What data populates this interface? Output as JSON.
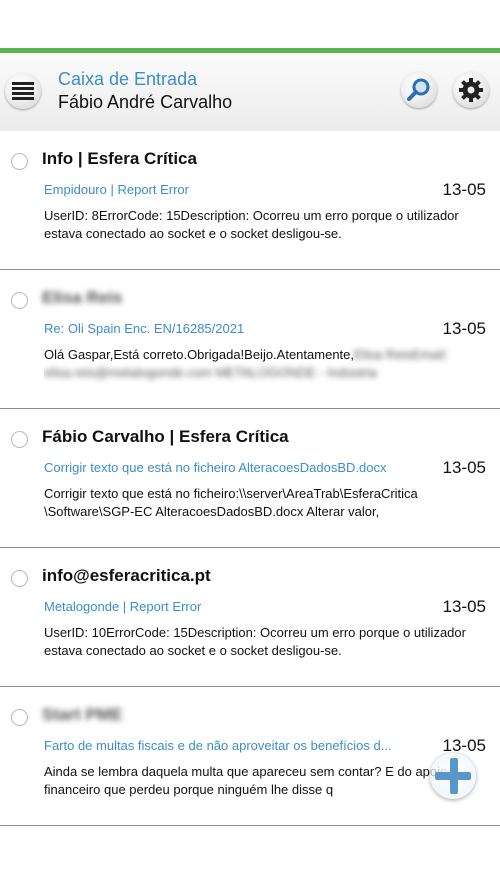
{
  "header": {
    "title": "Caixa de Entrada",
    "user": "Fábio André Carvalho",
    "menu_icon": "hamburger-menu-icon",
    "search_icon": "search-icon",
    "settings_icon": "gear-icon",
    "accent_color": "#3b8ec9",
    "status_bar_color": "#58b84b"
  },
  "messages": [
    {
      "sender": "Info | Esfera Crítica",
      "subject": "Empidouro | Report Error",
      "date": "13-05",
      "preview": "UserID: 8ErrorCode: 15Description: Ocorreu um erro porque o utilizador estava conectado ao socket e o socket desligou-se."
    },
    {
      "sender": "Elisa Reis",
      "subject": "Re:  Oli Spain Enc. EN/16285/2021",
      "date": "13-05",
      "preview": "Olá Gaspar,Está correto.Obrigada!Beijo.Atentamente,",
      "preview_blurred": "Elisa ReisEmail: elisa.reis@metalogonde.com METALOGONDE - Indústria"
    },
    {
      "sender": "Fábio Carvalho | Esfera Crítica",
      "subject": "Corrigir texto que está no ficheiro AlteracoesDadosBD.docx",
      "date": "13-05",
      "preview": "Corrigir texto que está no ficheiro:\\\\server\\AreaTrab\\EsferaCritica \\Software\\SGP-EC  AlteracoesDadosBD.docx Alterar valor,"
    },
    {
      "sender": "info@esferacritica.pt",
      "subject": "Metalogonde | Report Error",
      "date": "13-05",
      "preview": "UserID: 10ErrorCode: 15Description: Ocorreu um erro porque o utilizador estava conectado ao socket e o socket desligou-se."
    },
    {
      "sender": "Start PME",
      "subject": "Farto de multas fiscais e de não aproveitar os benefícios d...",
      "date": "13-05",
      "preview": "Ainda se lembra daquela multa que apareceu sem contar? E do apoio financeiro que perdeu  porque ninguém lhe disse q"
    }
  ],
  "fab": {
    "icon": "plus-icon"
  }
}
